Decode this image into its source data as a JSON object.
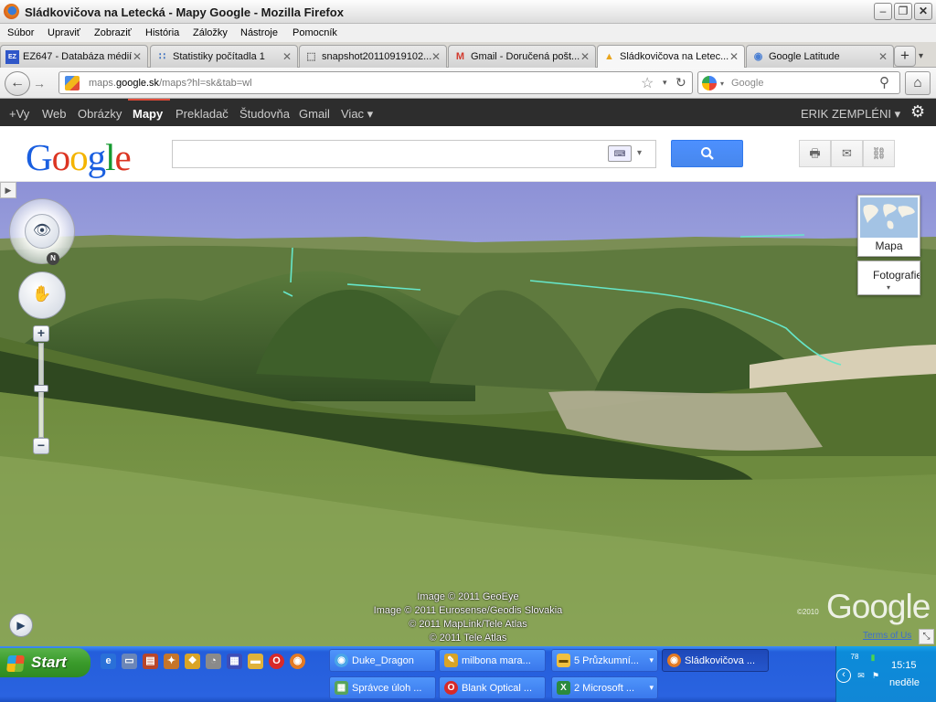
{
  "window": {
    "title": "Sládkovičova na Letecká - Mapy Google - Mozilla Firefox",
    "min": "–",
    "max": "❐",
    "close": "✕"
  },
  "menu": [
    "Súbor",
    "Upraviť",
    "Zobraziť",
    "História",
    "Záložky",
    "Nástroje",
    "Pomocník"
  ],
  "tabs": [
    {
      "label": "EZ647 - Databáza médií",
      "icon": "EZ",
      "icon_color": "#3057c8"
    },
    {
      "label": "Statistiky počítadla 1",
      "icon": "∷",
      "icon_color": "#3a6fbf"
    },
    {
      "label": "snapshot20110919102...",
      "icon": "⬚",
      "icon_color": "#666666"
    },
    {
      "label": "Gmail - Doručená pošt...",
      "icon": "M",
      "icon_color": "#d23b2f"
    },
    {
      "label": "Sládkovičova na Letec...",
      "icon": "▲",
      "icon_color": "#e9a51d"
    },
    {
      "label": "Google Latitude",
      "icon": "◉",
      "icon_color": "#4a7fd3"
    }
  ],
  "tab_close": "✕",
  "new_tab": "+",
  "tab_list": "▾",
  "nav": {
    "back": "←",
    "forward": "→",
    "url_prefix": "maps.",
    "url_domain": "google.sk",
    "url_path": "/maps?hl=sk&tab=wl",
    "star": "☆",
    "dropdown": "▾",
    "reload": "↻",
    "search_placeholder": "Google",
    "search_go": "⚲",
    "home": "⌂"
  },
  "gbar": {
    "items": [
      "+Vy",
      "Web",
      "Obrázky",
      "Mapy",
      "Prekladač",
      "Študovňa",
      "Gmail",
      "Viac ▾"
    ],
    "active": "Mapy",
    "user": "ERIK ZEMPLÉNI ▾",
    "gear": "⚙"
  },
  "gheader": {
    "logo": [
      "G",
      "o",
      "o",
      "g",
      "l",
      "e"
    ],
    "logo_colors": [
      "#1a5fe0",
      "#dc3522",
      "#f4b400",
      "#1a5fe0",
      "#159a2f",
      "#dc3522"
    ],
    "keyboard": "⌨",
    "kbd_drop": "▾",
    "search_button": "🔍",
    "tools": [
      "🖶",
      "✉",
      "⛓"
    ]
  },
  "map": {
    "sidebar_toggle": "▶",
    "compass_n": "N",
    "look_glyph": "👁",
    "pan_glyph": "✋",
    "zoom_in": "+",
    "zoom_out": "−",
    "maptype_label": "Mapa",
    "photo_label": "Fotografie",
    "photo_caret": "▾",
    "tour": "▶",
    "attribution": [
      "Image © 2011 GeoEye",
      "Image © 2011 Eurosense/Geodis Slovakia",
      "© 2011 MapLink/Tele Atlas",
      "© 2011 Tele Atlas"
    ],
    "logo": "Google",
    "logo_copy": "©2010",
    "terms": "Terms of Us",
    "resize": "⤡",
    "colors": {
      "sky": "#8d91d6",
      "forest": "#3f5a2c",
      "field": "#7e9a4a",
      "road": "#66e6c9"
    }
  },
  "taskbar": {
    "start": "Start",
    "quicklaunch": [
      {
        "glyph": "e",
        "color": "#2a70d8"
      },
      {
        "glyph": "▭",
        "color": "#6b86b8"
      },
      {
        "glyph": "▤",
        "color": "#b8462a"
      },
      {
        "glyph": "✦",
        "color": "#c6752a"
      },
      {
        "glyph": "❖",
        "color": "#d9a426"
      },
      {
        "glyph": "◔",
        "color": "#8a8a8a"
      },
      {
        "glyph": "▦",
        "color": "#3d4db8"
      },
      {
        "glyph": "▬",
        "color": "#e0b23a"
      },
      {
        "glyph": "O",
        "color": "#d72a2a"
      },
      {
        "glyph": "◉",
        "color": "#e47a23"
      }
    ],
    "buttons_row1": [
      {
        "label": "Duke_Dragon",
        "icon": "◉",
        "icon_color": "#4aa6e8",
        "arrow": ""
      },
      {
        "label": "milbona mara...",
        "icon": "✎",
        "icon_color": "#d9a426",
        "arrow": ""
      },
      {
        "label": "5 Průzkumní...",
        "icon": "▬",
        "icon_color": "#f0c040",
        "arrow": "▾"
      },
      {
        "label": "Sládkovičova ...",
        "icon": "◉",
        "icon_color": "#e47a23",
        "arrow": ""
      }
    ],
    "buttons_row2": [
      {
        "label": "Správce úloh ...",
        "icon": "▦",
        "icon_color": "#57a35b",
        "arrow": ""
      },
      {
        "label": "Blank Optical ...",
        "icon": "O",
        "icon_color": "#d72a2a",
        "arrow": ""
      },
      {
        "label": "2 Microsoft ...",
        "icon": "X",
        "icon_color": "#2b8a3e",
        "arrow": "▾"
      }
    ],
    "active_button": "Sládkovičova ...",
    "tray": {
      "time": "15:15",
      "day": "neděle",
      "collapse": "‹",
      "icons": [
        "78",
        "▮",
        "✉",
        "⚑"
      ]
    }
  }
}
